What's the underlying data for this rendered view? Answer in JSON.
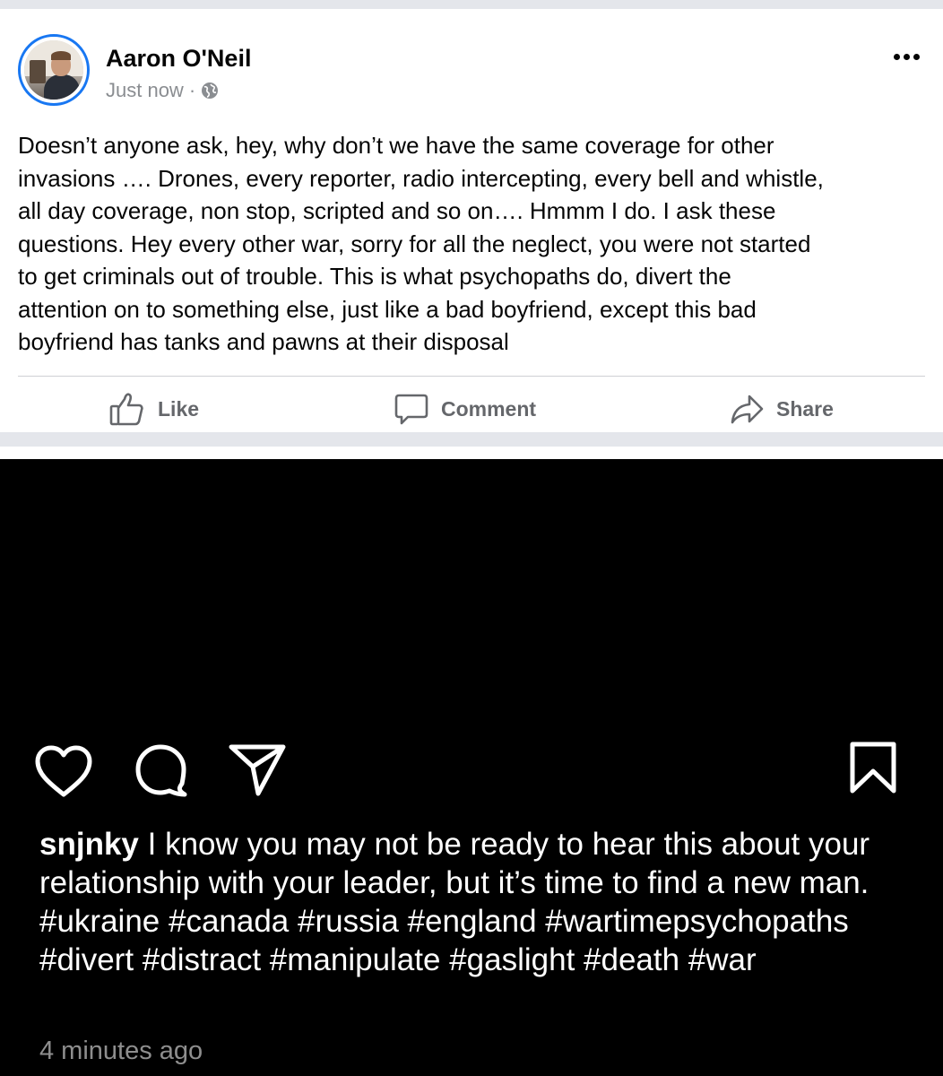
{
  "facebook_post": {
    "author": "Aaron O'Neil",
    "timestamp": "Just now ·",
    "audience_icon": "globe-icon",
    "menu_icon": "more-dots-icon",
    "text": "Doesn’t anyone ask, hey, why don’t we have the same coverage for other\ninvasions …. Drones, every reporter, radio intercepting, every bell and whistle,\nall day coverage, non stop, scripted and so on…. Hmmm I do. I ask these\nquestions. Hey every other war, sorry for all the neglect, you were not started\nto get criminals out of trouble. This is what psychopaths do, divert the\nattention on to something else, just like a bad boyfriend, except this bad\nboyfriend has tanks and pawns at their disposal",
    "actions": {
      "like": "Like",
      "comment": "Comment",
      "share": "Share"
    },
    "colors": {
      "avatar_ring": "#1877f2",
      "text": "#050505",
      "secondary": "#65676b"
    }
  },
  "instagram_post": {
    "icons": [
      "heart-icon",
      "comment-icon",
      "share-icon",
      "bookmark-icon"
    ],
    "username": "snjnky",
    "caption": " I know you may not be ready to hear this about your relationship with your leader, but it’s time to find a new man. #ukraine #canada #russia #england #wartimepsychopaths #divert #distract #manipulate #gaslight #death #war",
    "timestamp": "4 minutes ago",
    "colors": {
      "background": "#000000",
      "text": "#ffffff",
      "muted": "#8e8e8e"
    }
  }
}
